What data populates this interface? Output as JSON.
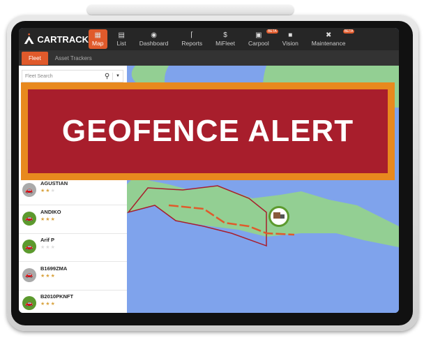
{
  "brand": "CARTRACK",
  "nav": [
    {
      "label": "Map",
      "icon": "map-icon",
      "active": true
    },
    {
      "label": "List",
      "icon": "list-icon"
    },
    {
      "label": "Dashboard",
      "icon": "gauge-icon"
    },
    {
      "label": "Reports",
      "icon": "chart-icon"
    },
    {
      "label": "MiFleet",
      "icon": "dollar-icon"
    },
    {
      "label": "Carpool",
      "icon": "calendar-icon",
      "badge": "BETA"
    },
    {
      "label": "Vision",
      "icon": "camera-icon"
    },
    {
      "label": "Maintenance",
      "icon": "tools-icon",
      "badge": "BETA"
    }
  ],
  "subnav": [
    {
      "label": "Fleet",
      "active": true
    },
    {
      "label": "Asset Trackers"
    }
  ],
  "search": {
    "placeholder": "Fleet Search"
  },
  "vehicles": [
    {
      "name": "AGUSTIAN",
      "rating": 2,
      "status": "grey"
    },
    {
      "name": "ANDIKO",
      "rating": 3,
      "status": "green"
    },
    {
      "name": "Arif P",
      "rating": 0,
      "status": "green"
    },
    {
      "name": "B1699ZMA",
      "rating": 3,
      "status": "grey"
    },
    {
      "name": "B2010PKNFT",
      "rating": 3,
      "status": "green"
    }
  ],
  "alert": "GEOFENCE ALERT",
  "colors": {
    "accent": "#e05a2b",
    "alert_bg": "#a81e2c",
    "alert_border": "#e8891e",
    "land": "#93cf93",
    "water": "#7fa3ec",
    "online": "#5c9a2e",
    "offline": "#aaaaaa"
  }
}
